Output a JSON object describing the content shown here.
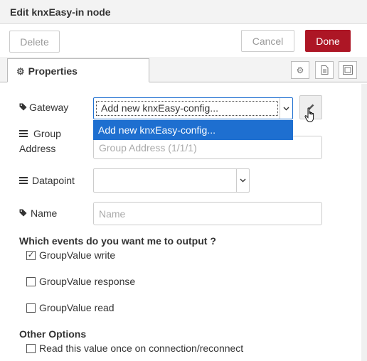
{
  "dialog": {
    "title": "Edit knxEasy-in node",
    "delete_label": "Delete",
    "cancel_label": "Cancel",
    "done_label": "Done",
    "accent_color": "#ad1625"
  },
  "tabs": {
    "properties_label": "Properties"
  },
  "form": {
    "gateway_label": "Gateway",
    "gateway_value": "Add new knxEasy-config...",
    "gateway_dropdown_option": "Add new knxEasy-config...",
    "group_label_line1": "Group",
    "group_label_line2": "Address",
    "group_placeholder": "Group Address (1/1/1)",
    "datapoint_label": "Datapoint",
    "datapoint_value": "",
    "name_label": "Name",
    "name_placeholder": "Name"
  },
  "events": {
    "heading": "Which events do you want me to output ?",
    "options": [
      {
        "label": "GroupValue write",
        "checked": true
      },
      {
        "label": "GroupValue response",
        "checked": false
      },
      {
        "label": "GroupValue read",
        "checked": false
      }
    ]
  },
  "other": {
    "heading": "Other Options",
    "read_once_label": "Read this value once on connection/reconnect",
    "read_once_checked": false
  },
  "colors": {
    "selection_blue": "#1e6fd0"
  }
}
